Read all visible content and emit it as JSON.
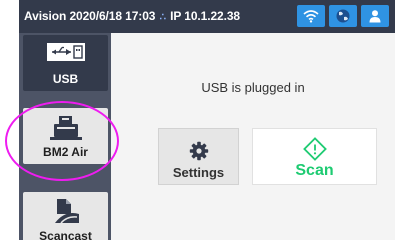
{
  "status_bar": {
    "brand": "Avision",
    "datetime": "2020/6/18 17:03",
    "network_icon": "network-dots-icon",
    "ip": "IP 10.1.22.38",
    "icons": [
      "wifi-icon",
      "globe-icon",
      "user-icon"
    ]
  },
  "sidebar": {
    "items": [
      {
        "label": "USB",
        "icon": "usb-icon",
        "active": true
      },
      {
        "label": "BM2 Air",
        "icon": "scanner-icon",
        "active": false
      },
      {
        "label": "Scancast",
        "icon": "scancast-icon",
        "active": false
      }
    ]
  },
  "main": {
    "message": "USB is plugged in",
    "settings_label": "Settings",
    "scan_label": "Scan"
  },
  "colors": {
    "statusbar_bg": "#333a4b",
    "sidebar_bg": "#4d5466",
    "accent_blue": "#2f93e3",
    "scan_green": "#1ecb72",
    "highlight_magenta": "#ee1cf0"
  }
}
